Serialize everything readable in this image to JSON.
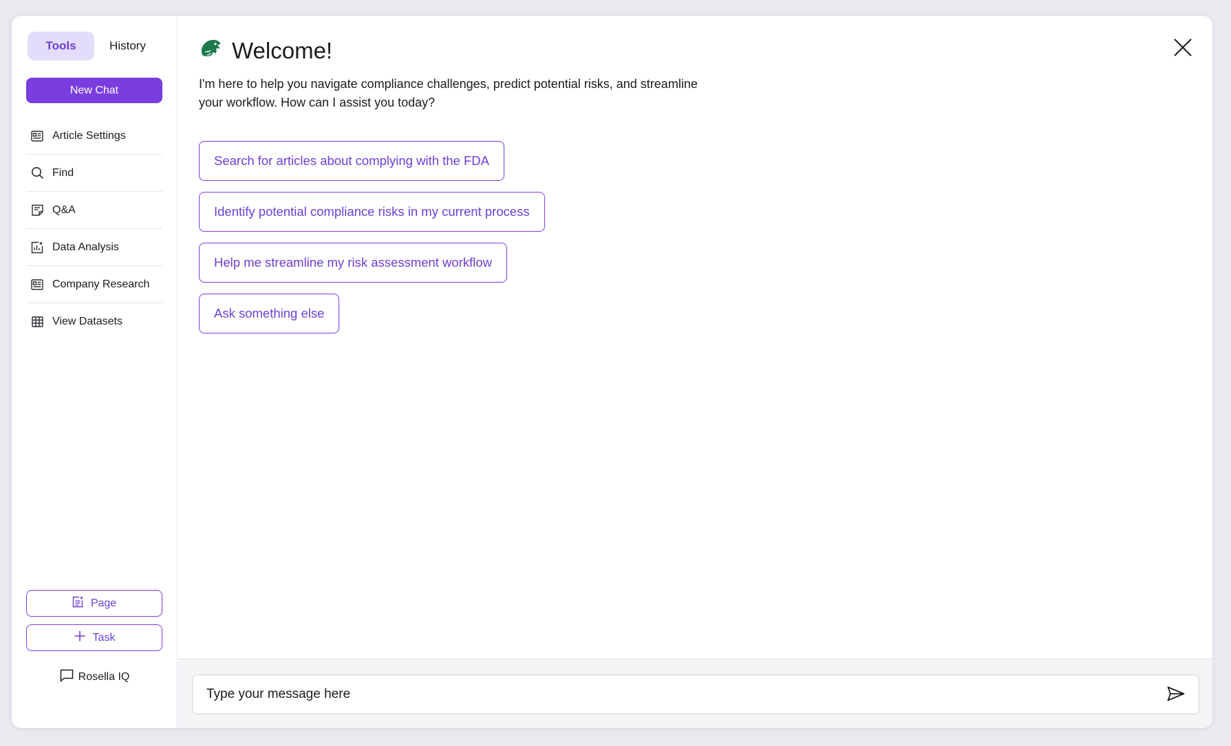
{
  "sidebar": {
    "tabs": [
      {
        "label": "Tools",
        "active": true
      },
      {
        "label": "History",
        "active": false
      }
    ],
    "new_chat_label": "New Chat",
    "items": [
      {
        "label": "Article Settings",
        "icon": "article-icon"
      },
      {
        "label": "Find",
        "icon": "search-icon"
      },
      {
        "label": "Q&A",
        "icon": "note-icon"
      },
      {
        "label": "Data Analysis",
        "icon": "chart-icon"
      },
      {
        "label": "Company Research",
        "icon": "article-icon"
      },
      {
        "label": "View Datasets",
        "icon": "table-icon"
      }
    ],
    "page_label": "Page",
    "task_label": "Task",
    "brand_label": "Rosella IQ"
  },
  "main": {
    "title": "Welcome!",
    "intro": "I'm here to help you navigate compliance challenges, predict potential risks, and streamline your workflow. How can I assist you today?",
    "suggestions": [
      "Search for articles about complying with the FDA",
      "Identify potential compliance risks in my current process",
      "Help me streamline my risk assessment workflow",
      "Ask something else"
    ],
    "composer_placeholder": "Type your message here"
  },
  "colors": {
    "accent": "#7a3de0",
    "accent_text": "#6b3fd6",
    "accent_soft": "#e3dcfa",
    "logo_green": "#1f7a4a"
  }
}
